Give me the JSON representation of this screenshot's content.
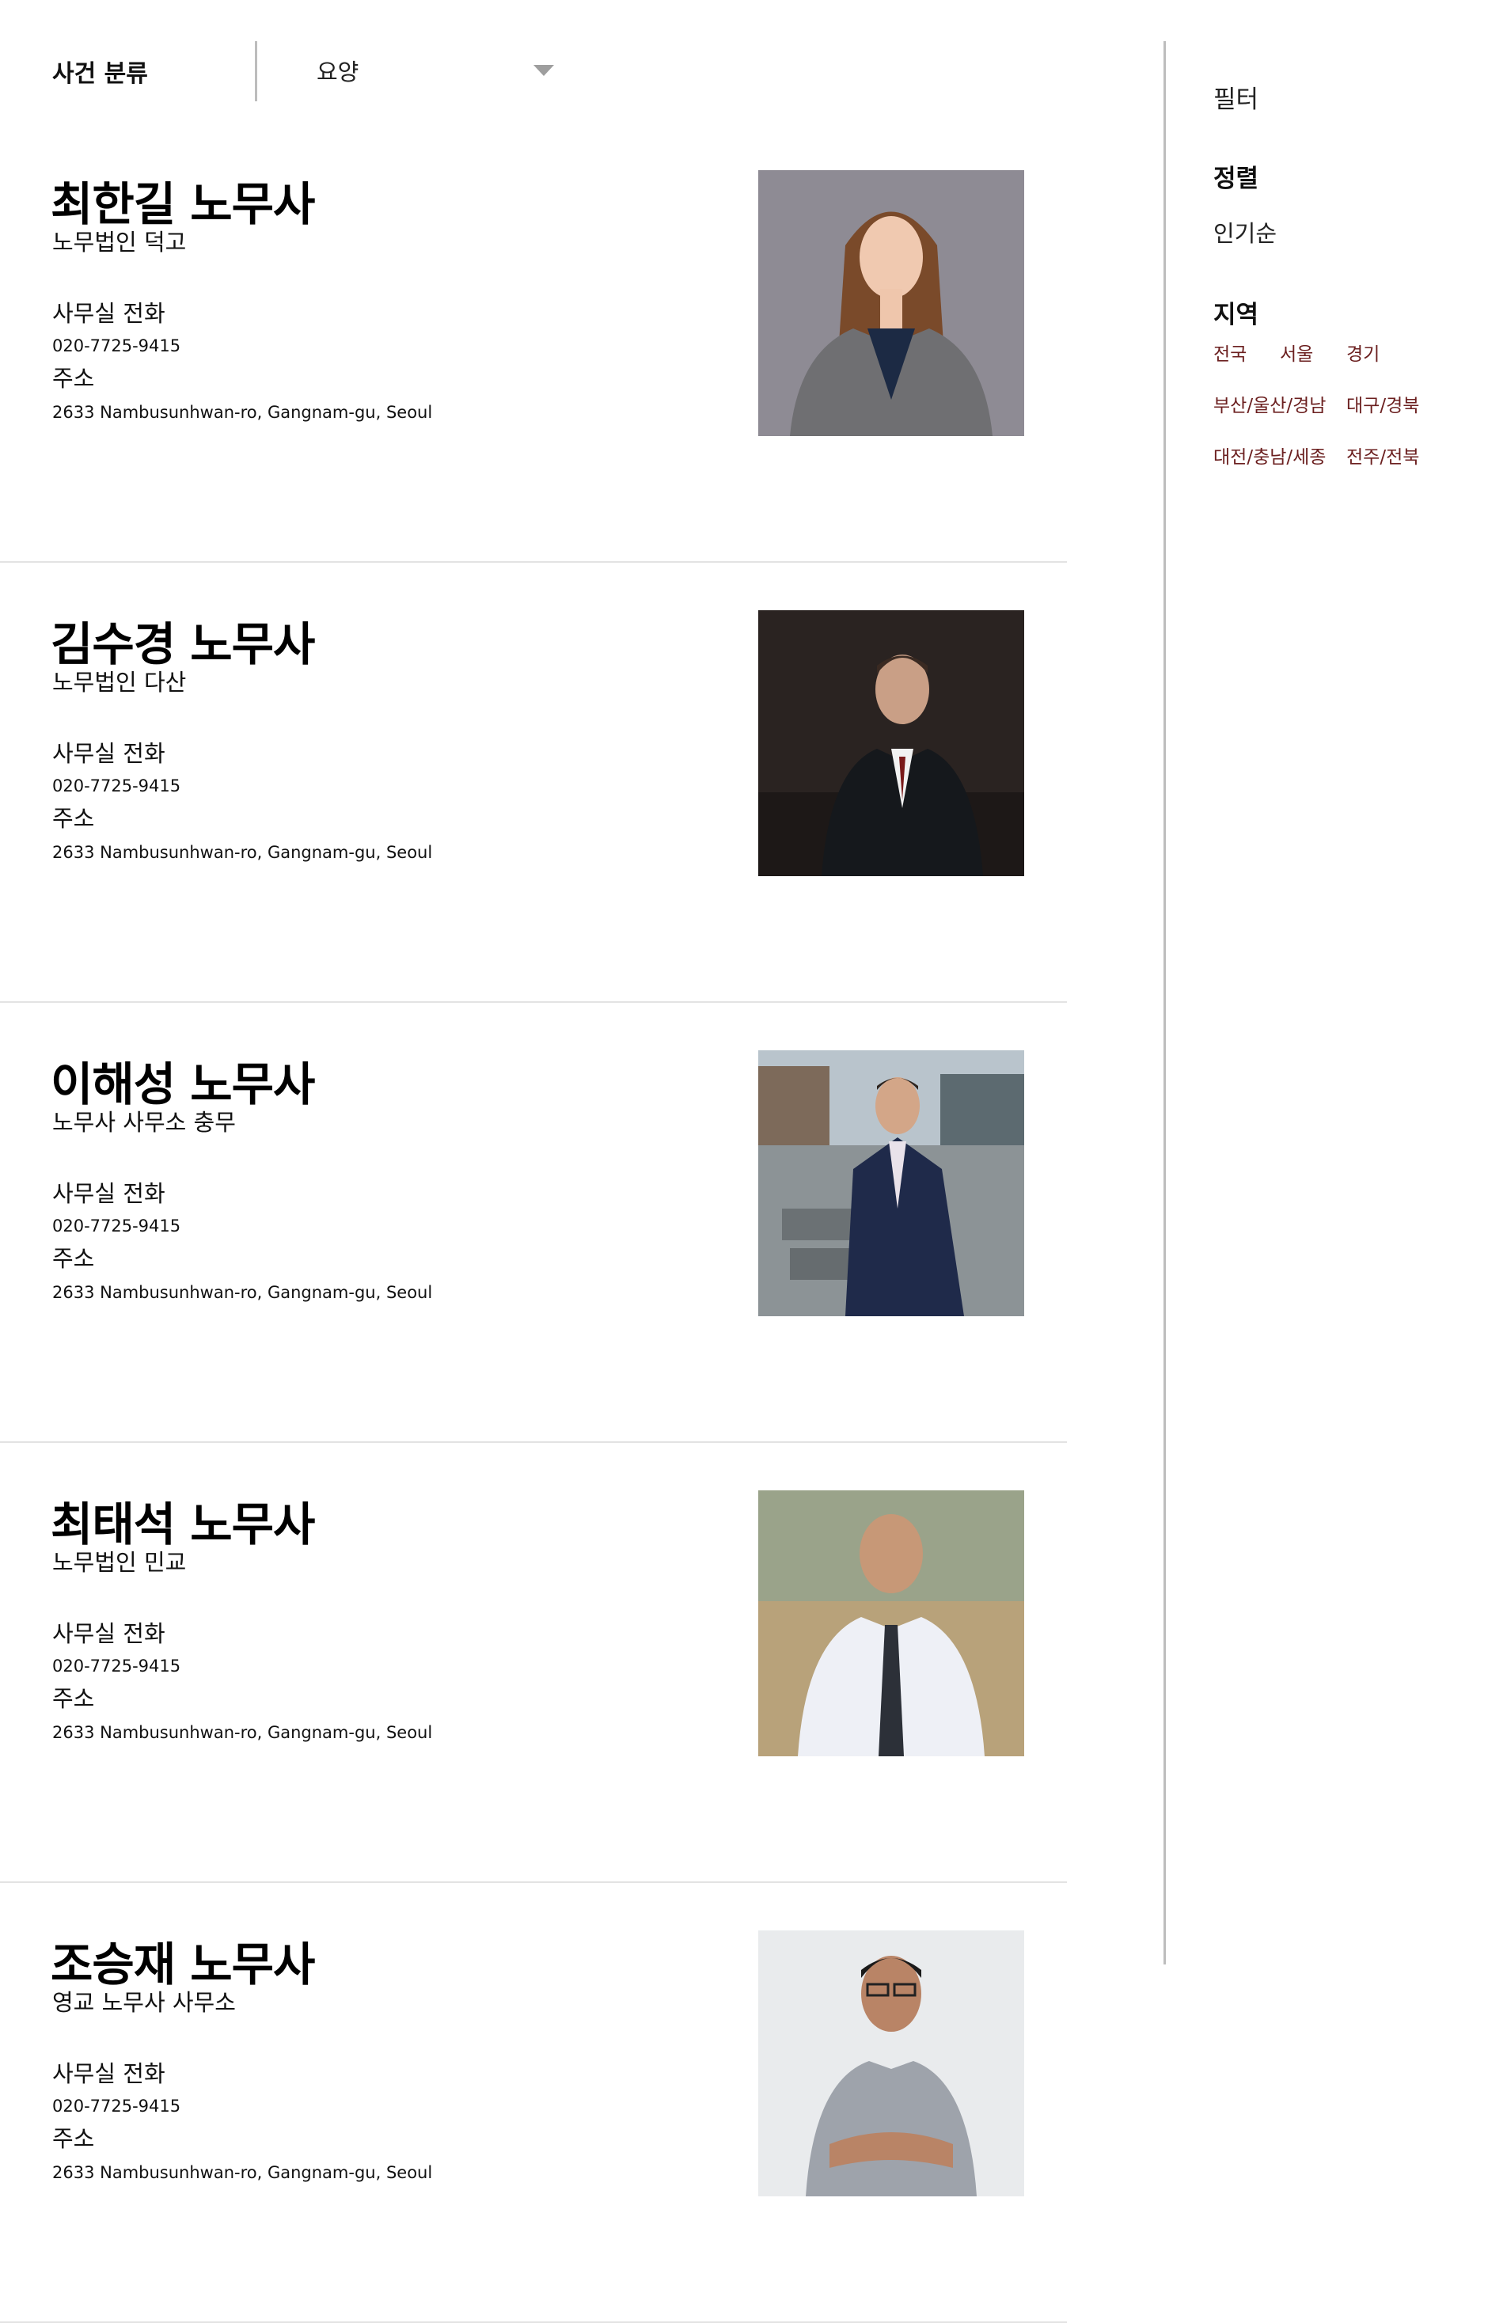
{
  "header": {
    "category_label": "사건 분류",
    "select_value": "요양",
    "caret_icon": "chevron-down-icon"
  },
  "lawyers": [
    {
      "name": "최한길 노무사",
      "firm": "노무법인 덕고",
      "phone_label": "사무실 전화",
      "phone": "020-7725-9415",
      "address_label": "주소",
      "address": "2633 Nambusunhwan-ro, Gangnam-gu, Seoul",
      "photo": "woman-gray-suit-portrait"
    },
    {
      "name": "김수경 노무사",
      "firm": "노무법인 다산",
      "phone_label": "사무실 전화",
      "phone": "020-7725-9415",
      "address_label": "주소",
      "address": "2633 Nambusunhwan-ro, Gangnam-gu, Seoul",
      "photo": "man-dark-suit-portrait"
    },
    {
      "name": "이해성 노무사",
      "firm": "노무사 사무소 충무",
      "phone_label": "사무실 전화",
      "phone": "020-7725-9415",
      "address_label": "주소",
      "address": "2633 Nambusunhwan-ro, Gangnam-gu, Seoul",
      "photo": "man-navy-suit-city-portrait"
    },
    {
      "name": "최태석 노무사",
      "firm": "노무법인 민교",
      "phone_label": "사무실 전화",
      "phone": "020-7725-9415",
      "address_label": "주소",
      "address": "2633 Nambusunhwan-ro, Gangnam-gu, Seoul",
      "photo": "man-white-shirt-tie-portrait"
    },
    {
      "name": "조승재 노무사",
      "firm": "영교 노무사 사무소",
      "phone_label": "사무실 전화",
      "phone": "020-7725-9415",
      "address_label": "주소",
      "address": "2633 Nambusunhwan-ro, Gangnam-gu, Seoul",
      "photo": "man-gray-tshirt-glasses-portrait"
    }
  ],
  "sidebar": {
    "filter_title": "필터",
    "sort_title": "정렬",
    "sort_value": "인기순",
    "region_title": "지역",
    "regions": [
      [
        "전국",
        "서울",
        "경기"
      ],
      [
        "부산/울산/경남",
        "대구/경북"
      ],
      [
        "대전/충남/세종",
        "전주/전북"
      ]
    ]
  },
  "colors": {
    "region_link": "#6b1f1f",
    "divider": "#bdbdbd",
    "card_border": "#e3e3e3"
  }
}
